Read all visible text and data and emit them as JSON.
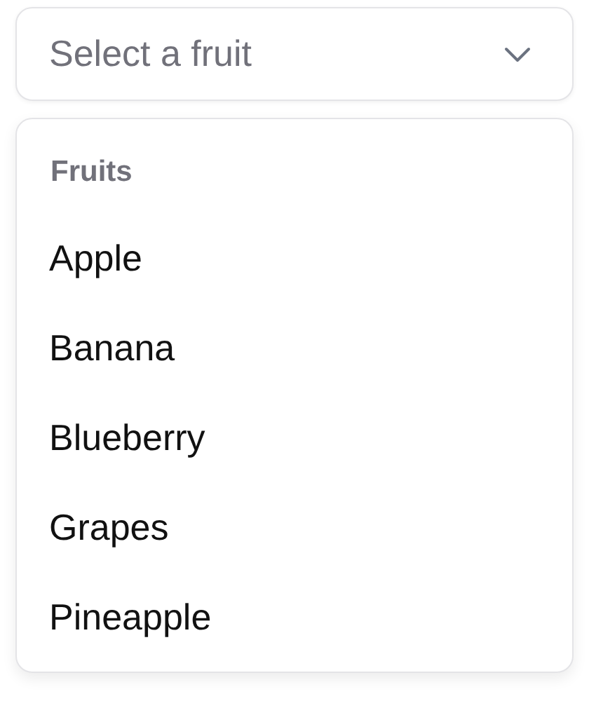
{
  "select": {
    "placeholder": "Select a fruit",
    "expanded": true
  },
  "menu": {
    "group_label": "Fruits",
    "items": [
      {
        "label": "Apple",
        "selected": false
      },
      {
        "label": "Banana",
        "selected": false
      },
      {
        "label": "Blueberry",
        "selected": false
      },
      {
        "label": "Grapes",
        "selected": false
      },
      {
        "label": "Pineapple",
        "selected": false
      }
    ]
  }
}
